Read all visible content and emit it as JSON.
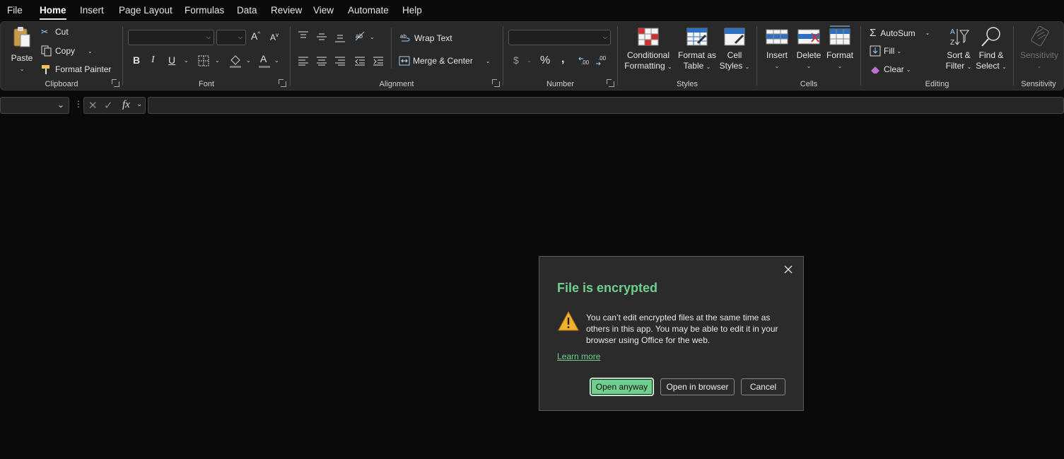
{
  "menu": {
    "tabs": [
      "File",
      "Home",
      "Insert",
      "Page Layout",
      "Formulas",
      "Data",
      "Review",
      "View",
      "Automate",
      "Help"
    ],
    "active_tab": "Home"
  },
  "ribbon": {
    "clipboard": {
      "label": "Clipboard",
      "paste": "Paste",
      "cut": "Cut",
      "copy": "Copy",
      "format_painter": "Format Painter"
    },
    "font": {
      "label": "Font",
      "font_name": "",
      "font_size": ""
    },
    "alignment": {
      "label": "Alignment",
      "wrap_text": "Wrap Text",
      "merge_center": "Merge & Center"
    },
    "number": {
      "label": "Number",
      "format": ""
    },
    "styles": {
      "label": "Styles",
      "conditional_1": "Conditional",
      "conditional_2": "Formatting",
      "format_table_1": "Format as",
      "format_table_2": "Table",
      "cell_styles_1": "Cell",
      "cell_styles_2": "Styles"
    },
    "cells": {
      "label": "Cells",
      "insert": "Insert",
      "delete": "Delete",
      "format": "Format"
    },
    "editing": {
      "label": "Editing",
      "autosum": "AutoSum",
      "fill": "Fill",
      "clear": "Clear",
      "sort_1": "Sort &",
      "sort_2": "Filter",
      "find_1": "Find &",
      "find_2": "Select"
    },
    "sensitivity": {
      "label": "Sensitivity",
      "button": "Sensitivity"
    }
  },
  "formula_bar": {
    "name_box": "",
    "formula": ""
  },
  "dialog": {
    "title": "File is encrypted",
    "message": "You can’t edit encrypted files at the same time as others in this app. You may be able to edit it in your browser using Office for the web.",
    "learn_more": "Learn more",
    "open_anyway": "Open anyway",
    "open_in_browser": "Open in browser",
    "cancel": "Cancel"
  },
  "colors": {
    "accent": "#6fcf8f",
    "ribbon_bg": "#292929",
    "page_bg": "#0a0a0a",
    "dialog_bg": "#2b2b2b"
  }
}
